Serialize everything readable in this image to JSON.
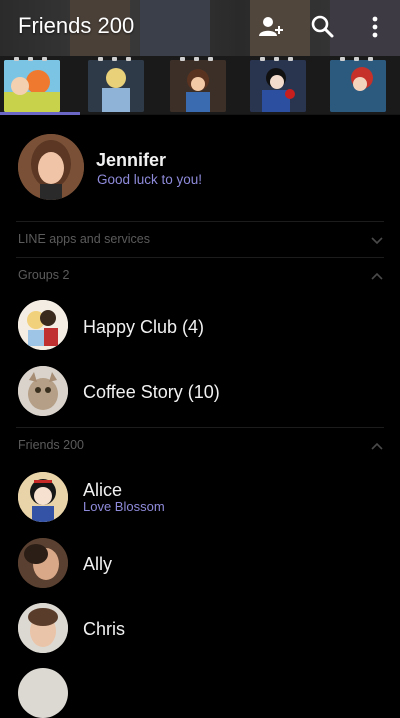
{
  "header": {
    "title": "Friends 200"
  },
  "profile": {
    "name": "Jennifer",
    "status": "Good luck to you!"
  },
  "sections": {
    "line_apps": "LINE apps and services",
    "groups": "Groups 2",
    "friends": "Friends 200"
  },
  "groups": [
    {
      "name": "Happy Club (4)"
    },
    {
      "name": "Coffee Story (10)"
    }
  ],
  "friends": [
    {
      "name": "Alice",
      "status": "Love Blossom"
    },
    {
      "name": "Ally",
      "status": ""
    },
    {
      "name": "Chris",
      "status": ""
    }
  ],
  "colors": {
    "accent": "#6b67c7",
    "status_text": "#8f8bdb",
    "section_text": "#5b5b5b"
  }
}
